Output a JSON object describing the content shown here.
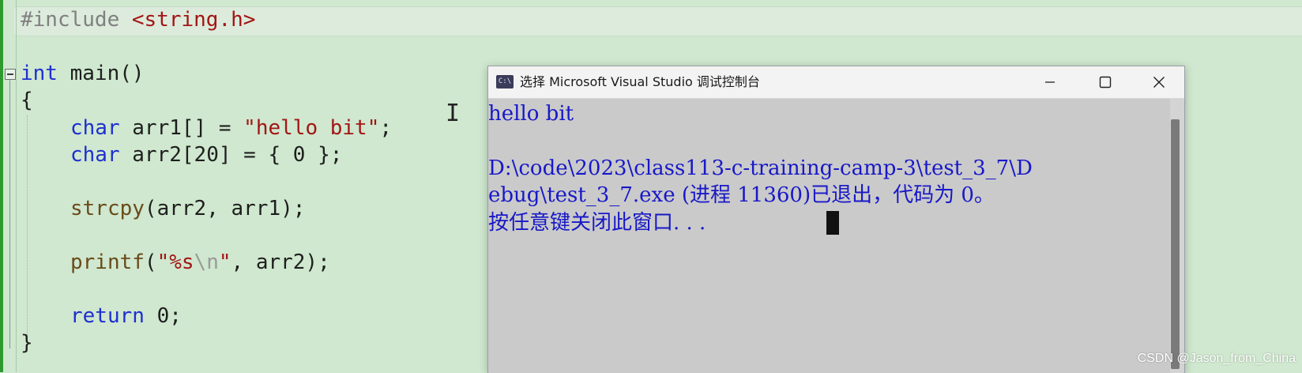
{
  "editor": {
    "lines": {
      "include_directive": "#include",
      "include_header": "<string.h>",
      "main_type": "int",
      "main_sig": " main()",
      "open_brace": "{",
      "l1_type": "char",
      "l1_rest": " arr1[] = ",
      "l1_string": "\"hello bit\"",
      "l1_end": ";",
      "l2_type": "char",
      "l2_rest": " arr2[20] = { 0 };",
      "l3_fn": "strcpy",
      "l3_rest": "(arr2, arr1);",
      "l4_fn": "printf",
      "l4_open": "(",
      "l4_str_start": "\"%s",
      "l4_escape": "\\n",
      "l4_str_end": "\"",
      "l4_rest": ", arr2);",
      "l5_kw": "return",
      "l5_rest": " 0;",
      "close_brace": "}"
    }
  },
  "console": {
    "icon_label": "C:\\",
    "title": "选择 Microsoft Visual Studio 调试控制台",
    "output": [
      "hello bit",
      "",
      "D:\\code\\2023\\class113-c-training-camp-3\\test_3_7\\D",
      "ebug\\test_3_7.exe (进程 11360)已退出，代码为 0。",
      "按任意键关闭此窗口. . ."
    ]
  },
  "watermark": "CSDN @Jason_from_China",
  "colors": {
    "editor_background": "#cfe8cf",
    "keyword": "#1f2fd0",
    "string": "#a31515",
    "console_text": "#1818c8",
    "console_background": "#cacaca"
  }
}
